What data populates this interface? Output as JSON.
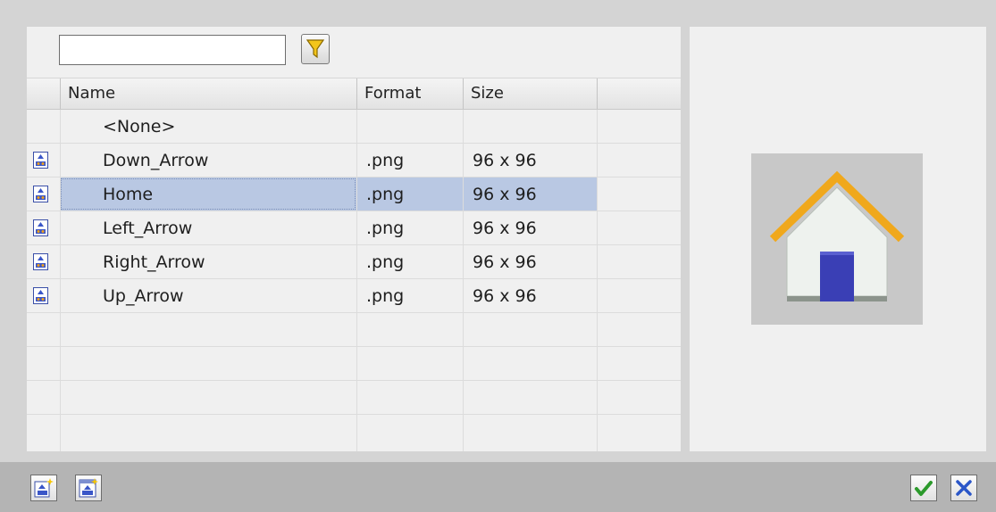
{
  "search": {
    "value": "",
    "placeholder": ""
  },
  "filter": {
    "icon": "filter-funnel-icon",
    "color": "#f3c51b"
  },
  "table": {
    "columns": [
      "Name",
      "Format",
      "Size"
    ],
    "rows": [
      {
        "name": "<None>",
        "format": "",
        "size": "",
        "icon": "",
        "selected": false
      },
      {
        "name": "Down_Arrow",
        "format": ".png",
        "size": "96 x 96",
        "icon": "image-file-icon",
        "selected": false
      },
      {
        "name": "Home",
        "format": ".png",
        "size": "96 x 96",
        "icon": "image-file-icon",
        "selected": true
      },
      {
        "name": "Left_Arrow",
        "format": ".png",
        "size": "96 x 96",
        "icon": "image-file-icon",
        "selected": false
      },
      {
        "name": "Right_Arrow",
        "format": ".png",
        "size": "96 x 96",
        "icon": "image-file-icon",
        "selected": false
      },
      {
        "name": "Up_Arrow",
        "format": ".png",
        "size": "96 x 96",
        "icon": "image-file-icon",
        "selected": false
      }
    ]
  },
  "preview": {
    "icon": "home-house-icon",
    "roof_color": "#f0a81c",
    "door_color": "#3a3fb5"
  },
  "toolbar": {
    "buttons": [
      "add-graphic-icon",
      "add-graphic-from-file-icon"
    ],
    "confirm_icon": "checkmark-icon",
    "cancel_icon": "close-x-icon",
    "confirm_color": "#2c9a2c",
    "cancel_color": "#2b56c8"
  },
  "colors": {
    "selection": "#b9c8e3",
    "panel": "#f0f0f0",
    "background": "#d4d4d4"
  }
}
